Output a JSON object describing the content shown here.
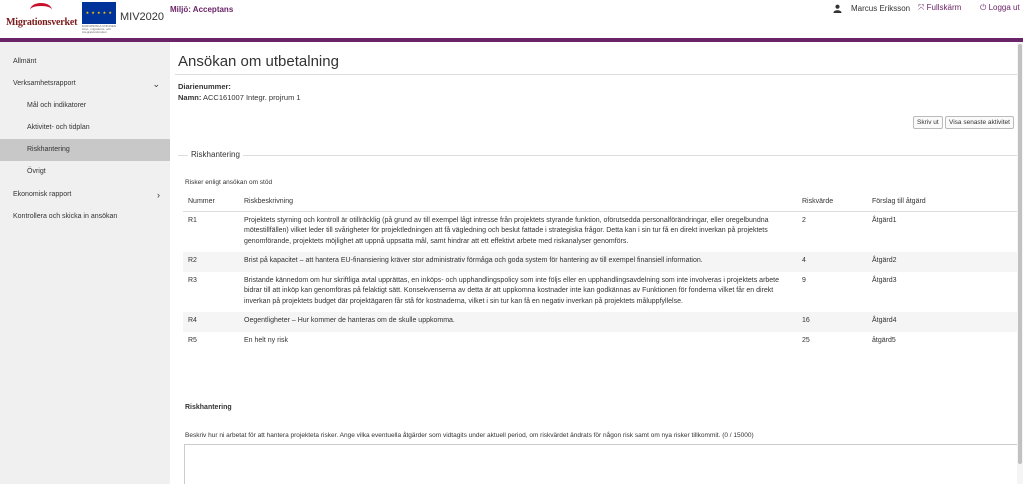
{
  "header": {
    "logo_text": "Migrationsverket",
    "eu_text": "EUROPEISKA UNIONEN Asyl-, migrations- och integrationsfonden",
    "app_name": "MIV2020",
    "environment": "Miljö: Acceptans",
    "user_name": "Marcus Eriksson",
    "fullscreen_label": "Fullskärm",
    "logout_label": "Logga ut"
  },
  "sidebar": {
    "items": [
      {
        "label": "Allmänt"
      },
      {
        "label": "Verksamhetsrapport"
      },
      {
        "label": "Mål och indikatorer"
      },
      {
        "label": "Aktivitet- och tidplan"
      },
      {
        "label": "Riskhantering"
      },
      {
        "label": "Övrigt"
      },
      {
        "label": "Ekonomisk rapport"
      },
      {
        "label": "Kontrollera och skicka in ansökan"
      }
    ]
  },
  "main": {
    "title": "Ansökan om utbetalning",
    "diarienummer_label": "Diarienummer:",
    "namn_label": "Namn:",
    "namn_value": "ACC161007 Integr. projrum 1",
    "print_button": "Skriv ut",
    "latest_activity_button": "Visa senaste aktivitet",
    "section_legend": "Riskhantering",
    "risk_intro": "Risker enligt ansökan om stöd",
    "table_headers": {
      "num": "Nummer",
      "desc": "Riskbeskrivning",
      "value": "Riskvärde",
      "action": "Förslag till åtgärd"
    },
    "risks": [
      {
        "num": "R1",
        "desc": "Projektets styrning och kontroll är otillräcklig (på grund av till exempel lågt intresse från projektets styrande funktion, oförutsedda personalförändringar, eller oregelbundna mötestillfällen) vilket leder till svårigheter för projektledningen att få vägledning och beslut fattade i strategiska frågor. Detta kan i sin tur få en direkt inverkan på projektets genomförande, projektets möjlighet att uppnå uppsatta mål, samt hindrar att ett effektivt arbete med riskanalyser genomförs.",
        "value": "2",
        "action": "Åtgärd1"
      },
      {
        "num": "R2",
        "desc": "Brist på kapacitet – att hantera EU-finansiering kräver stor administrativ förmåga och goda system för hantering av till exempel finansiell information.",
        "value": "4",
        "action": "Åtgärd2"
      },
      {
        "num": "R3",
        "desc": "Bristande kännedom om hur skriftliga avtal upprättas, en inköps- och upphandlingspolicy som inte följs eller en upphandlingsavdelning som inte involveras i projektets arbete bidrar till att inköp kan genomföras på felaktigt sätt. Konsekvenserna av detta är att uppkomna kostnader inte kan godkännas av Funktionen för fonderna vilket får en direkt inverkan på projektets budget där projektägaren får stå för kostnaderna, vilket i sin tur kan få en negativ inverkan på projektets måluppfyllelse.",
        "value": "9",
        "action": "Åtgärd3"
      },
      {
        "num": "R4",
        "desc": "Oegentligheter – Hur kommer de hanteras om de skulle uppkomma.",
        "value": "16",
        "action": "Åtgärd4"
      },
      {
        "num": "R5",
        "desc": "En helt ny risk",
        "value": "25",
        "action": "åtgärd5"
      }
    ],
    "riskhantering_label": "Riskhantering",
    "riskhantering_help": "Beskriv hur ni arbetat för att hantera projekteta risker. Ange vilka eventuella åtgärder som vidtagits under aktuell period, om riskvärdet ändrats för någon risk samt om nya risker tillkommit. (0 / 15000)",
    "riskhantering_value": ""
  },
  "colors": {
    "brand": "#6b2468",
    "sidebar_bg": "#f0f0f0",
    "sidebar_active": "#c8c8c8"
  }
}
